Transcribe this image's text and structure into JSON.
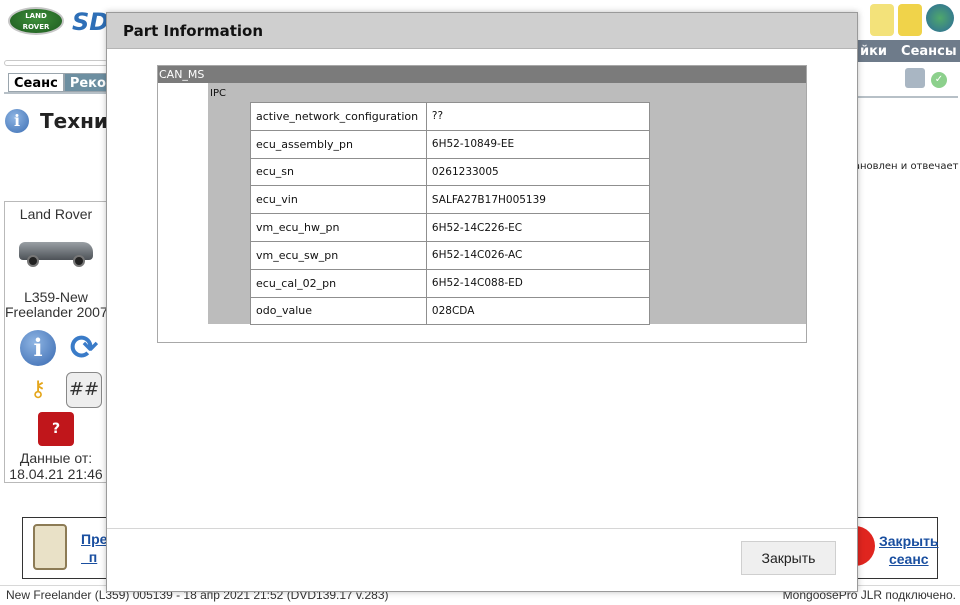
{
  "app": {
    "logo_text": "LAND\nROVER",
    "sdd_logo": "SD",
    "menu_right": [
      "йки",
      "Сеансы"
    ],
    "tabs": [
      "Сеанс",
      "Реком"
    ],
    "page_title": "Технич",
    "right_status": "тановлен и отвечает",
    "vehicle": {
      "brand": "Land Rover",
      "model_line1": "L359-New",
      "model_line2": "Freelander 2007",
      "date_label": "Данные от:",
      "date_value": "18.04.21 21:46"
    },
    "bottom_left_link": "Пре\nп",
    "bottom_right_link": "Закрыть\nсеанс",
    "status_left": "New Freelander (L359) 005139 - 18 апр 2021 21:52 (DVD139.17 v.283)",
    "status_right": "MongoosePro JLR подключено."
  },
  "dialog": {
    "title": "Part Information",
    "network": "CAN_MS",
    "module": "IPC",
    "rows": [
      {
        "key": "active_network_configuration",
        "value": "??"
      },
      {
        "key": "ecu_assembly_pn",
        "value": "6H52-10849-EE"
      },
      {
        "key": "ecu_sn",
        "value": "0261233005"
      },
      {
        "key": "ecu_vin",
        "value": "SALFA27B17H005139"
      },
      {
        "key": "vm_ecu_hw_pn",
        "value": "6H52-14C226-EC"
      },
      {
        "key": "vm_ecu_sw_pn",
        "value": "6H52-14C026-AC"
      },
      {
        "key": "ecu_cal_02_pn",
        "value": "6H52-14C088-ED"
      },
      {
        "key": "odo_value",
        "value": "028CDA"
      }
    ],
    "close_label": "Закрыть"
  }
}
